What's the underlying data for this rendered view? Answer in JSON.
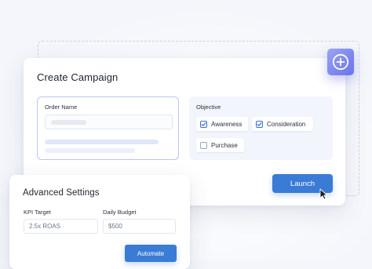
{
  "create_campaign": {
    "title": "Create Campaign",
    "order_name_label": "Order Name",
    "objective_label": "Objective",
    "objectives": [
      {
        "label": "Awareness",
        "checked": true
      },
      {
        "label": "Consideration",
        "checked": true
      },
      {
        "label": "Purchase",
        "checked": false
      }
    ],
    "launch_label": "Launch"
  },
  "add_button": {
    "icon": "plus-circle-icon"
  },
  "advanced_settings": {
    "title": "Advanced Settings",
    "kpi_target_label": "KPI Target",
    "kpi_target_value": "2.5x ROAS",
    "daily_budget_label": "Daily Budget",
    "daily_budget_value": "$500",
    "automate_label": "Automate"
  },
  "colors": {
    "accent": "#3a7bd5",
    "tile_gradient_start": "#9aa4f5",
    "tile_gradient_end": "#6a73e8",
    "background": "#f4f6fb"
  }
}
